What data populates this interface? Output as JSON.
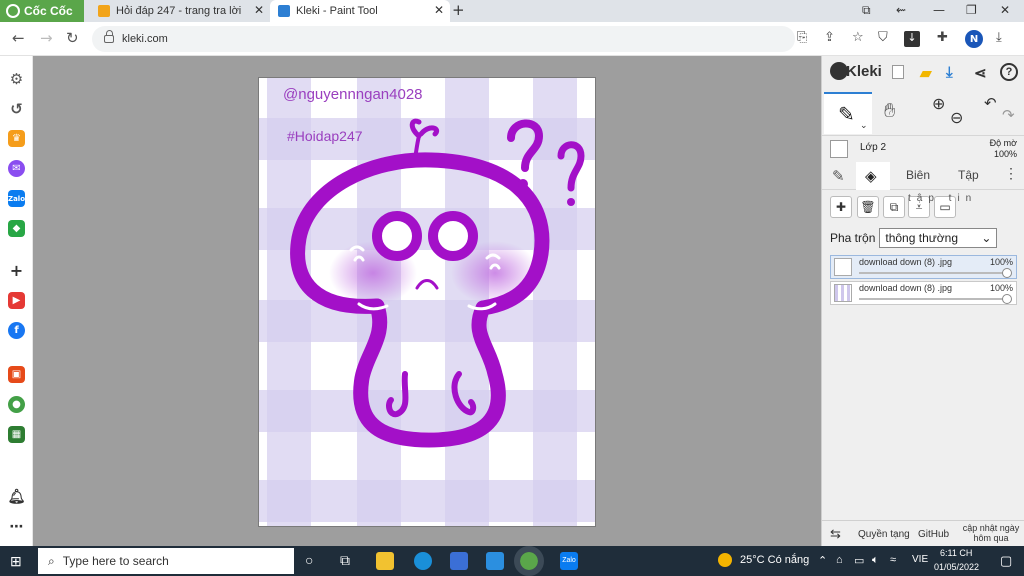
{
  "browser": {
    "brand": "Cốc Cốc",
    "tabs": [
      {
        "title": "Hỏi đáp 247 - trang tra lời",
        "active": false
      },
      {
        "title": "Kleki - Paint Tool",
        "active": true
      }
    ],
    "url": "kleki.com",
    "profile_initial": "N"
  },
  "canvas": {
    "watermark_user": "@nguyennngan4028",
    "watermark_tag": "#Hoidap247"
  },
  "kleki": {
    "title": "Kleki",
    "layer_name": "Lớp 2",
    "opacity_label": "Độ mờ",
    "opacity_value": "100%",
    "tabs": [
      "Biên",
      "Tập"
    ],
    "tooltip": "tập tin",
    "blend_label": "Pha trộn",
    "blend_value": "thông thường",
    "layers": [
      {
        "name": "download down (8) .jpg",
        "opacity": "100%",
        "selected": true
      },
      {
        "name": "download down (8) .jpg",
        "opacity": "100%",
        "selected": false
      }
    ],
    "footer": {
      "swap": "⇆",
      "copyright": "Quyền tạng",
      "github": "GitHub",
      "update": "cập nhật ngày hôm qua"
    }
  },
  "taskbar": {
    "search_placeholder": "Type here to search",
    "weather": "25°C Có nắng",
    "lang": "VIE",
    "time": "6:11 CH",
    "date": "01/05/2022"
  },
  "colors": {
    "accent": "#2d7fd3",
    "brand": "#5aa64a",
    "purple": "#a310c8",
    "gingham": "#cfc7ec"
  }
}
